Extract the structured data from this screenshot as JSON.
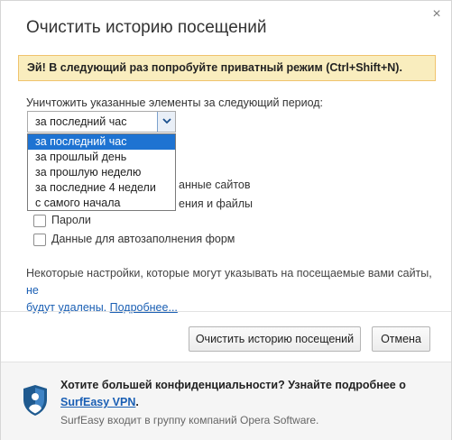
{
  "dialog": {
    "title": "Очистить историю посещений",
    "close_glyph": "×"
  },
  "banner": {
    "text": "Эй! В следующий раз попробуйте приватный режим (Ctrl+Shift+N)."
  },
  "period": {
    "label": "Уничтожить указанные элементы за следующий период:",
    "selected": "за последний час",
    "options": [
      "за последний час",
      "за прошлый день",
      "за прошлую неделю",
      "за последние 4 недели",
      "с самого начала"
    ]
  },
  "items": {
    "partial_1": "анные сайтов",
    "partial_2": "ения и файлы",
    "passwords": "Пароли",
    "autofill": "Данные для автозаполнения форм"
  },
  "note": {
    "text": "Некоторые настройки, которые могут указывать на посещаемые вами сайты, ",
    "link_part1": "не",
    "link_part2": "будут удалены.",
    "more_link": "Подробнее..."
  },
  "buttons": {
    "clear": "Очистить историю посещений",
    "cancel": "Отмена"
  },
  "promo": {
    "title": "Хотите большей конфиденциальности? Узнайте подробнее о",
    "link": "SurfEasy VPN",
    "link_suffix": ".",
    "subtitle": "SurfEasy входит в группу компаний Opera Software."
  }
}
